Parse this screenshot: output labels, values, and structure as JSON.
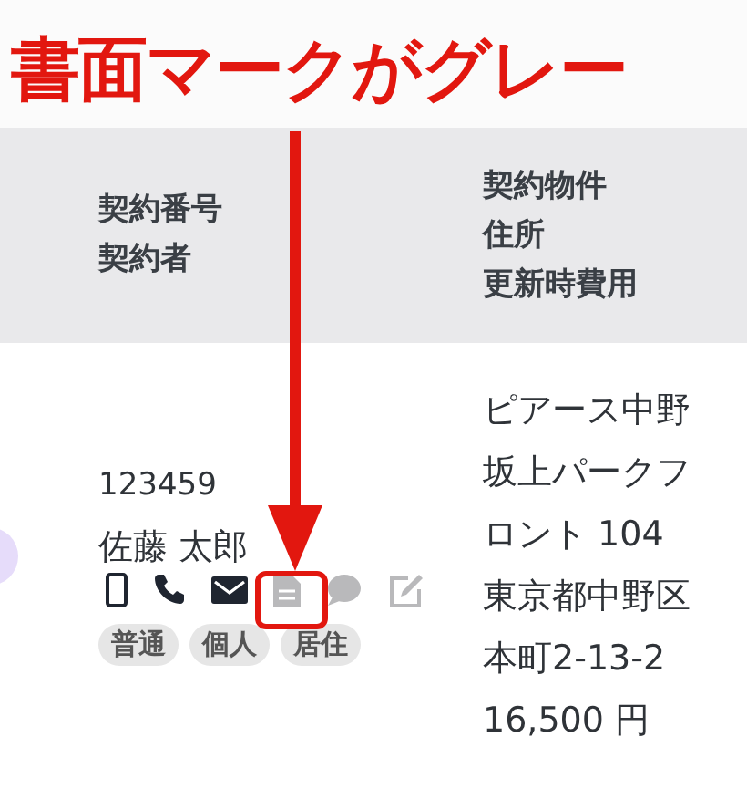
{
  "annotation": {
    "title": "書面マークがグレー"
  },
  "table": {
    "columns": [
      {
        "lines": [
          "契約番号",
          "契約者"
        ]
      },
      {
        "lines": [
          "契約物件",
          "住所",
          "更新時費用"
        ]
      }
    ],
    "rows": [
      {
        "contract_number": "123459",
        "contractor": "佐藤 太郎",
        "icons": [
          {
            "kind": "mobile",
            "active": true
          },
          {
            "kind": "phone",
            "active": true
          },
          {
            "kind": "mail",
            "active": true
          },
          {
            "kind": "document",
            "active": false
          },
          {
            "kind": "chat",
            "active": false
          },
          {
            "kind": "edit",
            "active": false
          }
        ],
        "tags": [
          "普通",
          "個人",
          "居住"
        ],
        "property": "ピアース中野坂上パークフロント 104",
        "address": "東京都中野区本町2-13-2",
        "fee": "16,500 円"
      }
    ]
  }
}
